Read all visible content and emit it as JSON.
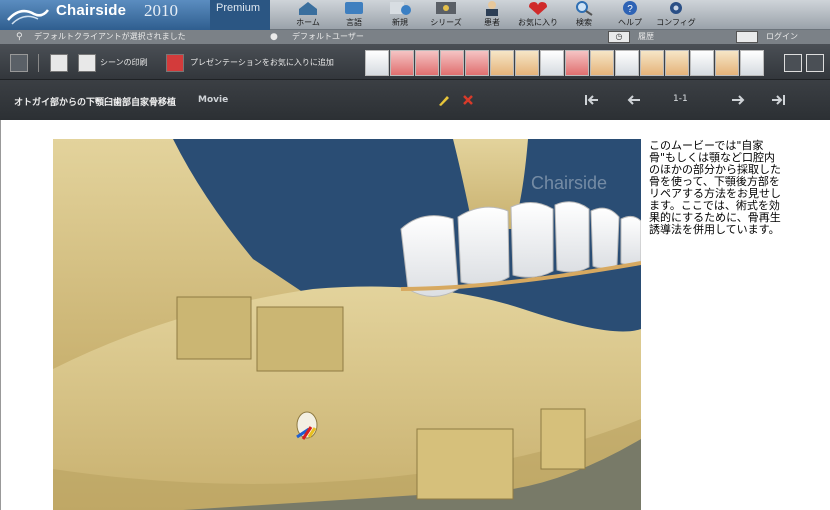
{
  "app": {
    "name": "Chairside",
    "year": "2010",
    "edition": "Premium"
  },
  "nav": [
    {
      "label": "ホーム",
      "icon": "home-icon"
    },
    {
      "label": "言語",
      "icon": "language-icon"
    },
    {
      "label": "新規",
      "icon": "new-icon"
    },
    {
      "label": "シリーズ",
      "icon": "series-icon"
    },
    {
      "label": "患者",
      "icon": "patient-icon"
    },
    {
      "label": "お気に入り",
      "icon": "favorite-icon"
    },
    {
      "label": "検索",
      "icon": "search-icon"
    },
    {
      "label": "ヘルプ",
      "icon": "help-icon"
    },
    {
      "label": "コンフィグ",
      "icon": "config-icon"
    }
  ],
  "status": {
    "client": "デフォルトクライアントが選択されました",
    "user": "デフォルトユーザー",
    "history": "履歴",
    "login": "ログイン"
  },
  "toolbar": {
    "print_scene": "シーンの印刷",
    "add_favorite": "プレゼンテーションをお気に入りに追加"
  },
  "movie": {
    "title": "オトガイ部からの下顎臼歯部自家骨移植",
    "type": "Movie",
    "page": "1-1"
  },
  "viewer": {
    "watermark": "Chairside"
  },
  "description": "このムービーでは\"自家骨\"もしくは顎など口腔内のほかの部分から採取した骨を使って、下顎後方部をリペアする方法をお見せします。ここでは、術式を効果的にするために、骨再生誘導法を併用しています。",
  "colors": {
    "brand": "#3d6fa3",
    "toolbar": "#3d4247",
    "bone": "#d9c48a",
    "ocean": "#2a4d74"
  }
}
